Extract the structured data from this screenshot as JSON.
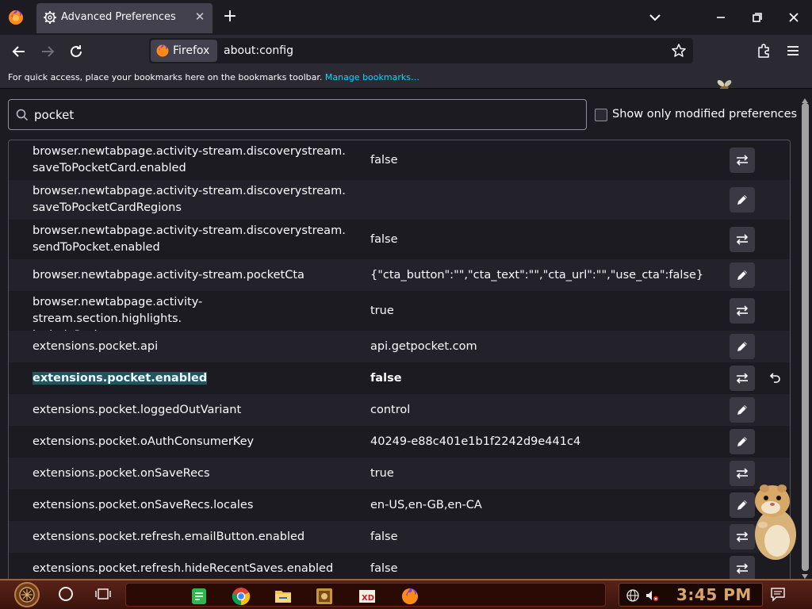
{
  "window": {
    "tab_title": "Advanced Preferences",
    "new_tab_symbol": "+",
    "close_tab_symbol": "✕"
  },
  "navbar": {
    "identity_label": "Firefox",
    "url": "about:config"
  },
  "bookmarks": {
    "hint": "For quick access, place your bookmarks here on the bookmarks toolbar.",
    "manage_link": "Manage bookmarks…"
  },
  "search": {
    "value": "pocket",
    "show_modified_label": "Show only modified preferences",
    "show_modified_checked": false
  },
  "prefs": [
    {
      "name_lines": [
        "browser.newtabpage.activity-stream.discoverystream.",
        "saveToPocketCard.enabled"
      ],
      "value": "false",
      "action": "toggle",
      "modified": false
    },
    {
      "name_lines": [
        "browser.newtabpage.activity-stream.discoverystream.",
        "saveToPocketCardRegions"
      ],
      "value": "",
      "action": "edit",
      "modified": false
    },
    {
      "name_lines": [
        "browser.newtabpage.activity-stream.discoverystream.",
        "sendToPocket.enabled"
      ],
      "value": "false",
      "action": "toggle",
      "modified": false
    },
    {
      "name_lines": [
        "browser.newtabpage.activity-stream.pocketCta"
      ],
      "value": "{\"cta_button\":\"\",\"cta_text\":\"\",\"cta_url\":\"\",\"use_cta\":false}",
      "action": "edit",
      "modified": false
    },
    {
      "name_lines": [
        "browser.newtabpage.activity-stream.section.highlights.",
        "includePocket"
      ],
      "value": "true",
      "action": "toggle",
      "modified": false
    },
    {
      "name_lines": [
        "extensions.pocket.api"
      ],
      "value": "api.getpocket.com",
      "action": "edit",
      "modified": false
    },
    {
      "name_lines": [
        "extensions.pocket.enabled"
      ],
      "value": "false",
      "action": "toggle",
      "modified": true
    },
    {
      "name_lines": [
        "extensions.pocket.loggedOutVariant"
      ],
      "value": "control",
      "action": "edit",
      "modified": false
    },
    {
      "name_lines": [
        "extensions.pocket.oAuthConsumerKey"
      ],
      "value": "40249-e88c401e1b1f2242d9e441c4",
      "action": "edit",
      "modified": false
    },
    {
      "name_lines": [
        "extensions.pocket.onSaveRecs"
      ],
      "value": "true",
      "action": "toggle",
      "modified": false
    },
    {
      "name_lines": [
        "extensions.pocket.onSaveRecs.locales"
      ],
      "value": "en-US,en-GB,en-CA",
      "action": "edit",
      "modified": false
    },
    {
      "name_lines": [
        "extensions.pocket.refresh.emailButton.enabled"
      ],
      "value": "false",
      "action": "toggle",
      "modified": false
    },
    {
      "name_lines": [
        "extensions.pocket.refresh.hideRecentSaves.enabled"
      ],
      "value": "false",
      "action": "toggle",
      "modified": false
    }
  ],
  "taskbar": {
    "clock": "3:45 PM",
    "apps": [
      "notes-app-icon",
      "chrome-icon",
      "file-explorer-icon",
      "game-icon",
      "xd-app-icon",
      "firefox-icon"
    ]
  },
  "colors": {
    "window_bg": "#1c1b22",
    "toolbar_bg": "#2b2a33",
    "tab_selected": "#42414d",
    "link": "#00ddff",
    "modified_highlight": "#23555f",
    "taskbar_bg": "#4a1a10",
    "clock_color": "#d8a56a"
  }
}
